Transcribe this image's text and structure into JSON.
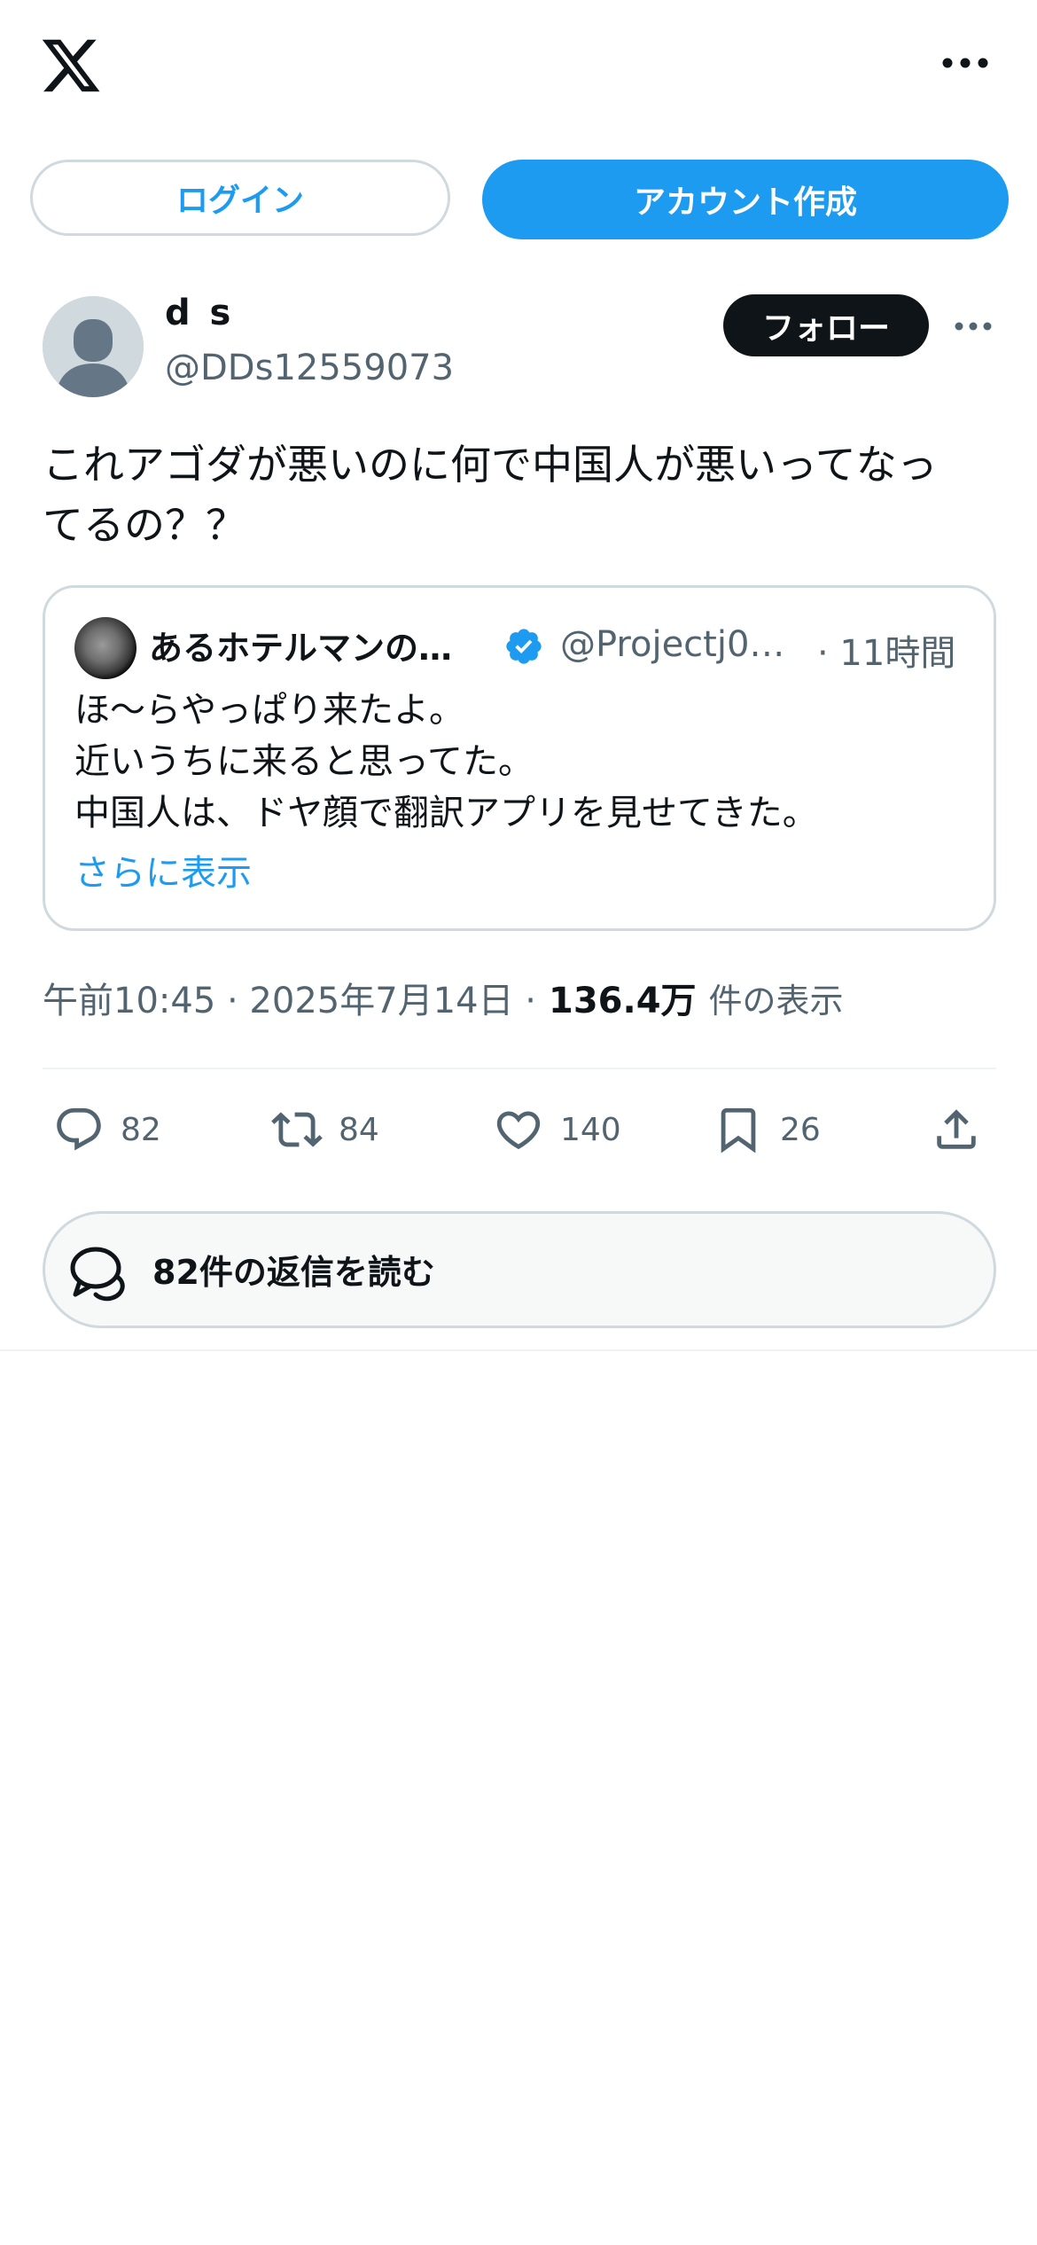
{
  "header": {
    "logo_icon": "x-logo-icon",
    "more_icon": "more-horizontal-icon",
    "login_label": "ログイン",
    "signup_label": "アカウント作成"
  },
  "post": {
    "author_name": "d s",
    "author_handle": "@DDs12559073",
    "follow_label": "フォロー",
    "text": "これアゴダが悪いのに何で中国人が悪いってなっ\nてるの？？",
    "quote": {
      "name": "あるホテルマンの…",
      "verified": true,
      "handle": "@Projectj0…",
      "time": "· 11時間",
      "text": "ほ〜らやっぱり来たよ。\n近いうちに来ると思ってた。\n中国人は、ドヤ顔で翻訳アプリを見せてきた。",
      "show_more": "さらに表示"
    },
    "timestamp": "午前10:45 · 2025年7月14日 ·",
    "views": "136.4万",
    "views_label": "件の表示",
    "actions": {
      "replies": "82",
      "reposts": "84",
      "likes": "140",
      "bookmarks": "26"
    },
    "read_replies_label": "82件の返信を読む"
  },
  "colors": {
    "accent": "#1d9bf0",
    "text": "#0f1419",
    "secondary": "#536471",
    "border": "#cfd9de"
  }
}
